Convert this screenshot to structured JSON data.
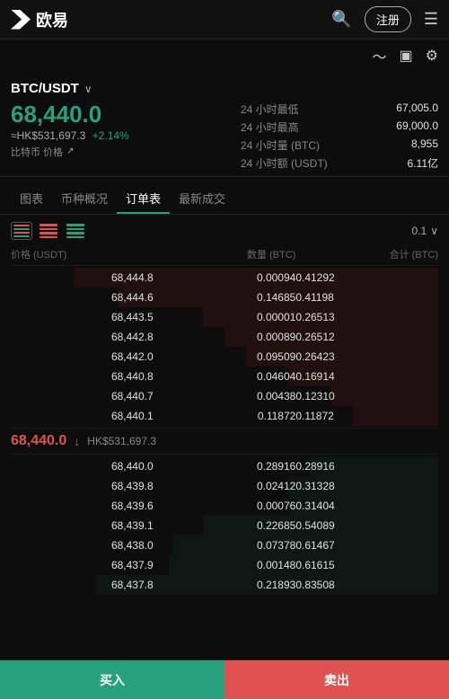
{
  "header": {
    "logo_text": "欧易",
    "register_label": "注册",
    "menu_icon": "☰"
  },
  "sub_header": {
    "chart_icon": "📈",
    "document_icon": "📋",
    "settings_icon": "⚙"
  },
  "price_info": {
    "pair": "BTC/USDT",
    "price": "68,440.0",
    "hk_price": "≈HK$531,697.3",
    "change_pct": "+2.14%",
    "sub_label": "比特币 价格",
    "stats": [
      {
        "label": "24 小时最低",
        "value": "67,005.0"
      },
      {
        "label": "24 小时最高",
        "value": "69,000.0"
      },
      {
        "label": "24 小时量 (BTC)",
        "value": "8,955"
      },
      {
        "label": "24 小时额 (USDT)",
        "value": "6.11亿"
      }
    ]
  },
  "tabs": [
    "图表",
    "币种概况",
    "订单表",
    "最新成交"
  ],
  "active_tab_index": 2,
  "orderbook": {
    "decimal_label": "0.1",
    "col_headers": [
      "价格 (USDT)",
      "数量 (BTC)",
      "合计 (BTC)"
    ],
    "sell_orders": [
      {
        "price": "68,444.8",
        "qty": "0.00094",
        "total": "0.41292",
        "bar_pct": 85
      },
      {
        "price": "68,444.6",
        "qty": "0.14685",
        "total": "0.41198",
        "bar_pct": 75
      },
      {
        "price": "68,443.5",
        "qty": "0.00001",
        "total": "0.26513",
        "bar_pct": 55
      },
      {
        "price": "68,442.8",
        "qty": "0.00089",
        "total": "0.26512",
        "bar_pct": 50
      },
      {
        "price": "68,442.0",
        "qty": "0.09509",
        "total": "0.26423",
        "bar_pct": 45
      },
      {
        "price": "68,440.8",
        "qty": "0.04604",
        "total": "0.16914",
        "bar_pct": 35
      },
      {
        "price": "68,440.7",
        "qty": "0.00438",
        "total": "0.12310",
        "bar_pct": 25
      },
      {
        "price": "68,440.1",
        "qty": "0.11872",
        "total": "0.11872",
        "bar_pct": 20
      }
    ],
    "mid_price": "68,440.0",
    "mid_hk": "HK$531,697.3",
    "buy_orders": [
      {
        "price": "68,440.0",
        "qty": "0.28916",
        "total": "0.28916",
        "bar_pct": 30
      },
      {
        "price": "68,439.8",
        "qty": "0.02412",
        "total": "0.31328",
        "bar_pct": 35
      },
      {
        "price": "68,439.6",
        "qty": "0.00076",
        "total": "0.31404",
        "bar_pct": 35
      },
      {
        "price": "68,439.1",
        "qty": "0.22685",
        "total": "0.54089",
        "bar_pct": 55
      },
      {
        "price": "68,438.0",
        "qty": "0.07378",
        "total": "0.61467",
        "bar_pct": 62
      },
      {
        "price": "68,437.9",
        "qty": "0.00148",
        "total": "0.61615",
        "bar_pct": 63
      },
      {
        "price": "68,437.8",
        "qty": "0.21893",
        "total": "0.83508",
        "bar_pct": 80
      }
    ]
  },
  "bottom": {
    "buy_label": "买入",
    "sell_label": "卖出"
  }
}
